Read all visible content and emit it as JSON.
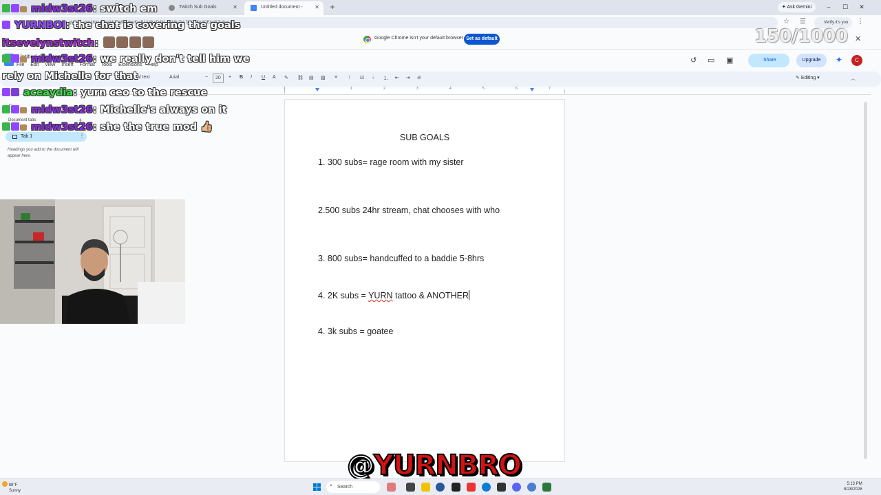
{
  "browser": {
    "tabs": [
      {
        "label": "",
        "active": false
      },
      {
        "label": "Twitch Sub Goals",
        "active": false
      },
      {
        "label": "Untitled document - Google Do",
        "active": true
      }
    ],
    "ask_gemini": "Ask Gemini",
    "url": "docs.google.com/document/d/1co9ir4dvuKrsB1AXKcDdM-amk8uZvL7tdr9*8uzKjE/edit?tab=t.0",
    "verify": "Verify it's you",
    "infobar_text": "Google Chrome isn't your default browser",
    "set_default": "Set as default"
  },
  "docs": {
    "title": "Untitled document",
    "menus": [
      "File",
      "Edit",
      "View",
      "Insert",
      "Format",
      "Tools",
      "Extensions",
      "Help"
    ],
    "share": "Share",
    "upgrade": "Upgrade",
    "avatar_letter": "C",
    "toolbar": {
      "style": "Normal text",
      "font": "Arial",
      "font_size": "20",
      "editing": "Editing"
    },
    "sidebar": {
      "tabs_label": "Document tabs",
      "tab_name": "Tab 1",
      "headings_note": "Headings you add to the document will appear here."
    },
    "ruler_numbers": [
      "1",
      "1",
      "2",
      "3",
      "4",
      "5",
      "6",
      "7"
    ],
    "content": {
      "heading": "SUB GOALS",
      "item1": "1. 300 subs= rage room with my sister",
      "item2": "2.500 subs 24hr stream, chat chooses with who",
      "item3": "3. 800 subs= handcuffed to a baddie 5-8hrs",
      "item4_prefix": "4. 2K subs = ",
      "item4_word": "YURN",
      "item4_suffix": " tattoo & ANOTHER",
      "item5": "4. 3k subs = goatee"
    }
  },
  "overlay": {
    "sub_counter": "150/1000",
    "brand_at": "@",
    "brand_name": "YURNBRO",
    "chat": [
      {
        "user": "midw3st26",
        "text": ": switch em",
        "color": "#8a2be2",
        "emotes": 0
      },
      {
        "user": "YURNBOI",
        "text": ": the chat is covering the goals",
        "color": "#9146ff",
        "emotes": 0
      },
      {
        "user": "itsevelynstwitch",
        "text": ": ",
        "color": "#a52ad6",
        "emotes": 4
      },
      {
        "user": "midw3st26",
        "text": ": we really don't tell him we",
        "color": "#8a2be2",
        "emotes": 0
      },
      {
        "user": "",
        "text": "rely on Michelle for that",
        "color": "#ffffff",
        "emotes": 0
      },
      {
        "user": "aceaydia",
        "text": ": yurn ceo to the rescue",
        "color": "#3adb45",
        "emotes": 0
      },
      {
        "user": "midw3st26",
        "text": ": Michelle's always on it",
        "color": "#8a2be2",
        "emotes": 0
      },
      {
        "user": "midw3st26",
        "text": ": she the true mod 👍🏼",
        "color": "#8a2be2",
        "emotes": 0
      }
    ]
  },
  "taskbar": {
    "temperature": "88°F",
    "condition": "Sunny",
    "search": "Search",
    "time": "5:13 PM",
    "date": "8/28/2026"
  }
}
